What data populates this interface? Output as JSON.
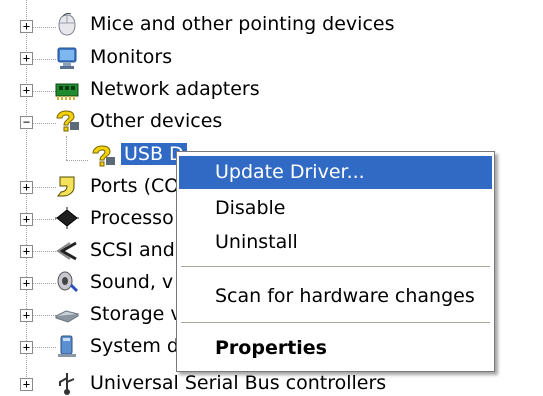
{
  "tree": {
    "items": [
      {
        "label": "Mice and other pointing devices",
        "icon": "mouse-icon"
      },
      {
        "label": "Monitors",
        "icon": "monitor-icon"
      },
      {
        "label": "Network adapters",
        "icon": "network-adapter-icon"
      },
      {
        "label": "Other devices",
        "icon": "unknown-device-icon"
      },
      {
        "label": "USB D",
        "icon": "unknown-device-icon"
      },
      {
        "label": "Ports (CO",
        "icon": "port-icon"
      },
      {
        "label": "Processo",
        "icon": "processor-icon"
      },
      {
        "label": "SCSI and",
        "icon": "scsi-icon"
      },
      {
        "label": "Sound, v",
        "icon": "sound-icon"
      },
      {
        "label": "Storage v",
        "icon": "storage-icon"
      },
      {
        "label": "System d",
        "icon": "system-device-icon"
      },
      {
        "label": "Universal Serial Bus controllers",
        "icon": "usb-icon"
      }
    ]
  },
  "context_menu": {
    "update_driver": "Update Driver...",
    "disable": "Disable",
    "uninstall": "Uninstall",
    "scan": "Scan for hardware changes",
    "properties": "Properties"
  },
  "colors": {
    "selection": "#316ac5",
    "menu_border": "#7a7a7a"
  }
}
